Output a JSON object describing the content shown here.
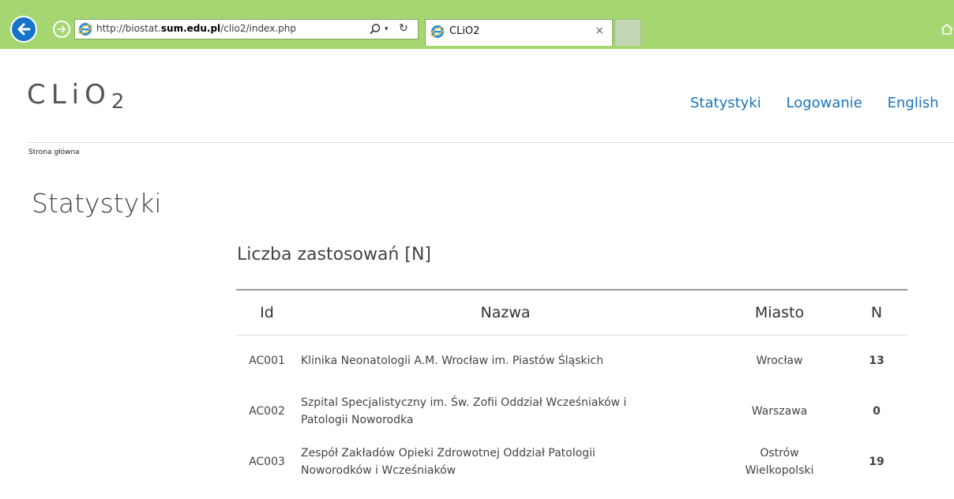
{
  "browser": {
    "url_prefix": "http://biostat.",
    "url_host": "sum.edu.pl",
    "url_path": "/clio2/index.php",
    "tab_title": "CLiO2",
    "tab_close": "×",
    "dropdown": "▾",
    "refresh": "↻"
  },
  "header": {
    "logo_main": "CLiO",
    "logo_sub": "2",
    "nav": [
      "Statystyki",
      "Logowanie",
      "English"
    ]
  },
  "breadcrumb": "Strona główna",
  "page_title": "Statystyki",
  "section_title": "Liczba zastosowań [N]",
  "table": {
    "headers": [
      "Id",
      "Nazwa",
      "Miasto",
      "N"
    ],
    "rows": [
      {
        "id": "AC001",
        "name": "Klinika Neonatologii A.M. Wrocław im. Piastów Śląskich",
        "city_line1": "Wrocław",
        "city_line2": "",
        "n": "13"
      },
      {
        "id": "AC002",
        "name_line1": "Szpital Specjalistyczny im. Św. Zofii Oddział Wcześniaków i",
        "name_line2": "Patologii Noworodka",
        "city_line1": "Warszawa",
        "city_line2": "",
        "n": "0"
      },
      {
        "id": "AC003",
        "name_line1": "Zespół Zakładów Opieki Zdrowotnej Oddział Patologii",
        "name_line2": "Noworodków i Wcześniaków",
        "city_line1": "Ostrów",
        "city_line2": "Wielkopolski",
        "n": "19"
      }
    ]
  },
  "colors": {
    "chrome": "#a6d672",
    "link": "#1b75bb",
    "back_button": "#1673c9"
  }
}
